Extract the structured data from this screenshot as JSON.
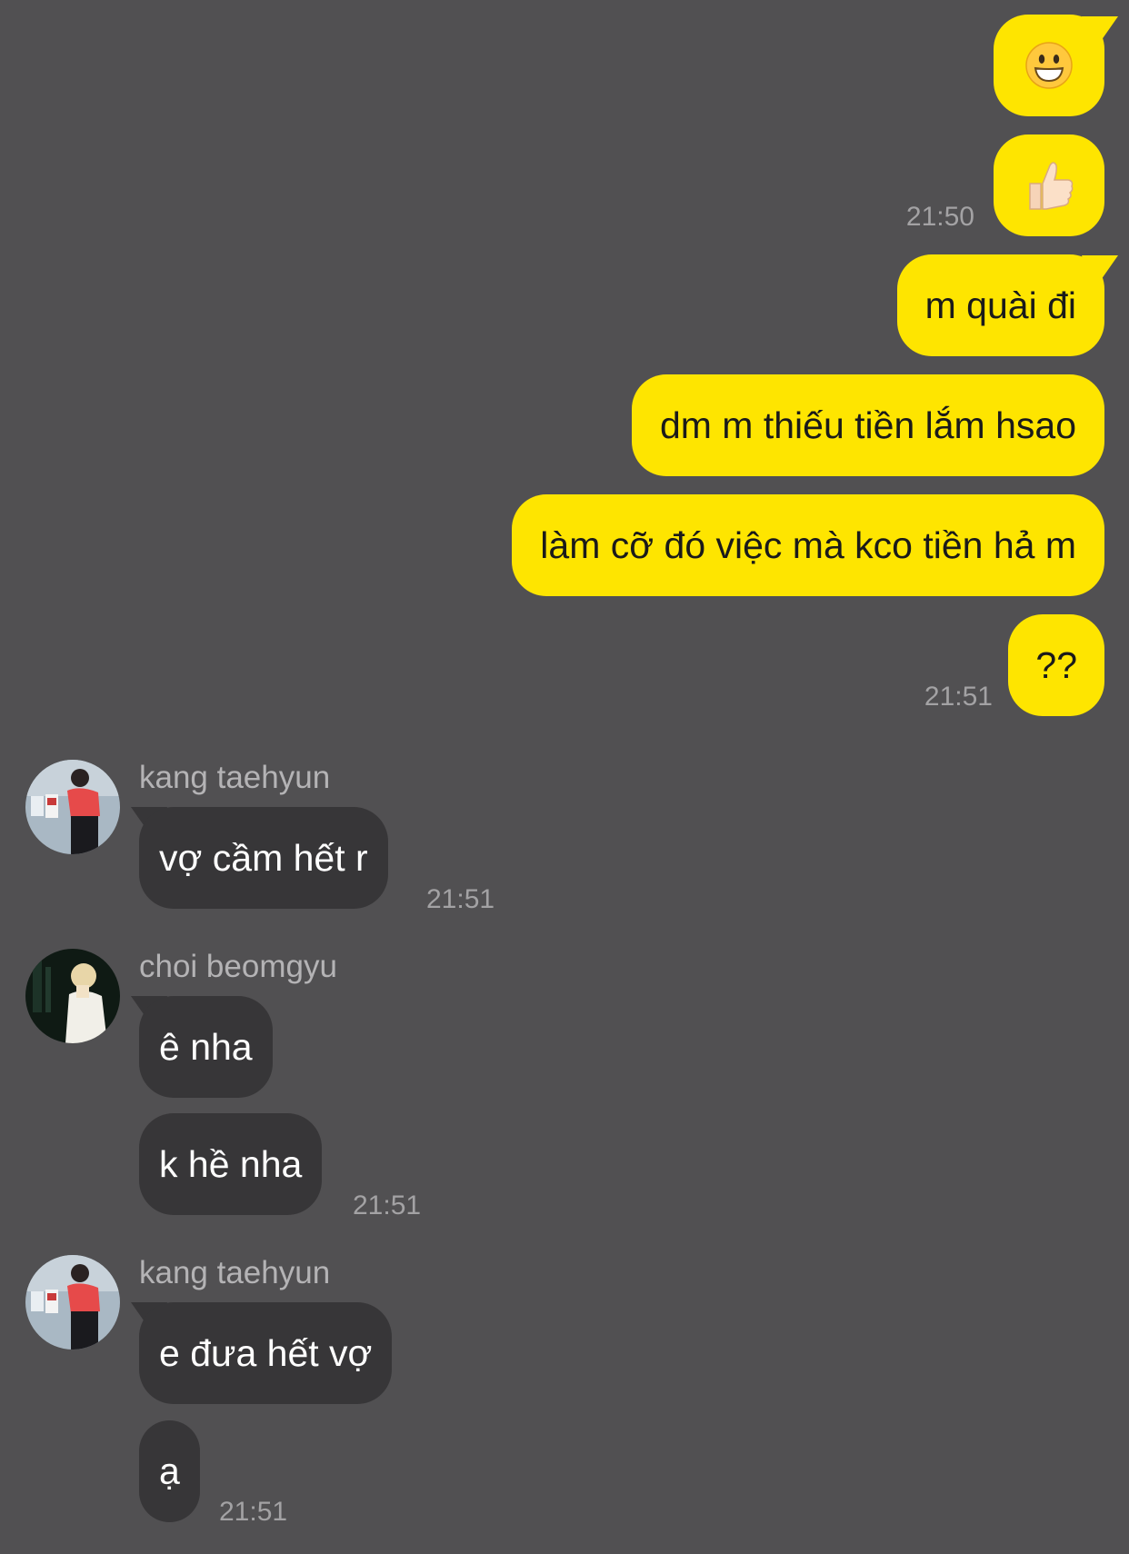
{
  "colors": {
    "background": "#515052",
    "outgoing_bubble": "#FEE500",
    "incoming_bubble": "#373638",
    "timestamp": "#a3a2a4",
    "sender_name": "#b4b3b5"
  },
  "outgoing": [
    {
      "text": "",
      "icon": "grinning-face-emoji"
    },
    {
      "text": "",
      "icon": "thumbs-up-emoji",
      "time": "21:50"
    },
    {
      "text": "m quài đi"
    },
    {
      "text": "dm m thiếu tiền lắm hsao"
    },
    {
      "text": "làm cỡ đó việc mà kco tiền hả m"
    },
    {
      "text": "??",
      "time": "21:51"
    }
  ],
  "incoming": [
    {
      "sender": "kang taehyun",
      "avatar_icon": "kang-taehyun-avatar",
      "messages": [
        {
          "text": "vợ cầm hết r"
        }
      ],
      "time": "21:51"
    },
    {
      "sender": "choi beomgyu",
      "avatar_icon": "choi-beomgyu-avatar",
      "messages": [
        {
          "text": "ê nha"
        },
        {
          "text": "k hề nha"
        }
      ],
      "time": "21:51"
    },
    {
      "sender": "kang taehyun",
      "avatar_icon": "kang-taehyun-avatar",
      "messages": [
        {
          "text": "e đưa hết vợ"
        },
        {
          "text": "ạ"
        }
      ],
      "time": "21:51"
    }
  ]
}
